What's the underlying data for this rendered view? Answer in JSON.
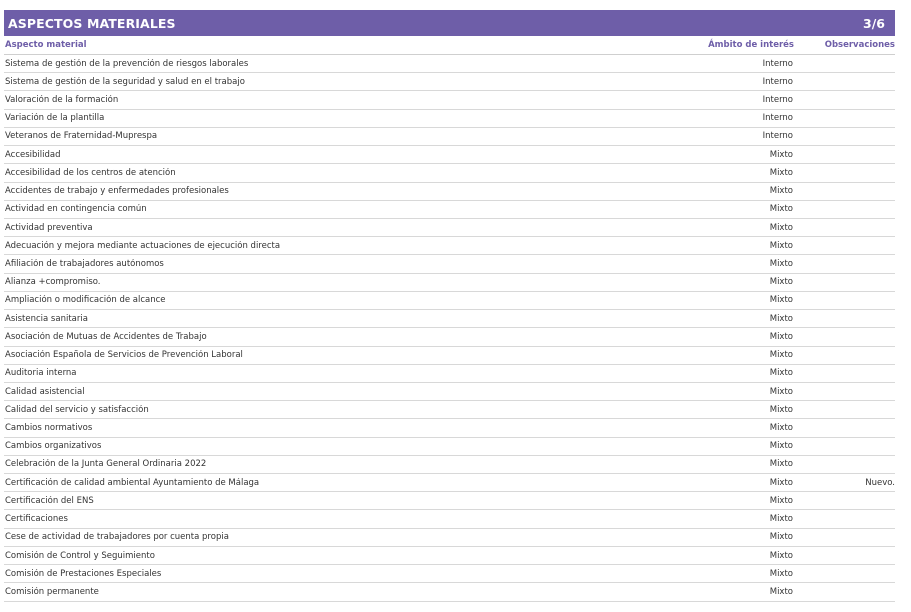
{
  "header": {
    "title": "ASPECTOS MATERIALES",
    "page_indicator": "3/6"
  },
  "columns": {
    "aspecto": "Aspecto material",
    "ambito": "Ámbito de interés",
    "observaciones": "Observaciones"
  },
  "colors": {
    "accent": "#6e5ea8"
  },
  "rows": [
    {
      "aspecto": "Sistema de gestión de la prevención de riesgos laborales",
      "ambito": "Interno",
      "observaciones": ""
    },
    {
      "aspecto": "Sistema de gestión de la seguridad y salud en el trabajo",
      "ambito": "Interno",
      "observaciones": ""
    },
    {
      "aspecto": "Valoración de la formación",
      "ambito": "Interno",
      "observaciones": ""
    },
    {
      "aspecto": "Variación de la plantilla",
      "ambito": "Interno",
      "observaciones": ""
    },
    {
      "aspecto": "Veteranos de Fraternidad-Muprespa",
      "ambito": "Interno",
      "observaciones": ""
    },
    {
      "aspecto": "Accesibilidad",
      "ambito": "Mixto",
      "observaciones": ""
    },
    {
      "aspecto": "Accesibilidad de los centros de atención",
      "ambito": "Mixto",
      "observaciones": ""
    },
    {
      "aspecto": "Accidentes de trabajo y enfermedades profesionales",
      "ambito": "Mixto",
      "observaciones": ""
    },
    {
      "aspecto": "Actividad en contingencia común",
      "ambito": "Mixto",
      "observaciones": ""
    },
    {
      "aspecto": "Actividad preventiva",
      "ambito": "Mixto",
      "observaciones": ""
    },
    {
      "aspecto": "Adecuación y mejora mediante actuaciones de ejecución directa",
      "ambito": "Mixto",
      "observaciones": ""
    },
    {
      "aspecto": "Afiliación de trabajadores autónomos",
      "ambito": "Mixto",
      "observaciones": ""
    },
    {
      "aspecto": "Alianza +compromiso.",
      "ambito": "Mixto",
      "observaciones": ""
    },
    {
      "aspecto": "Ampliación o modificación de alcance",
      "ambito": "Mixto",
      "observaciones": ""
    },
    {
      "aspecto": "Asistencia sanitaria",
      "ambito": "Mixto",
      "observaciones": ""
    },
    {
      "aspecto": "Asociación de Mutuas de Accidentes de Trabajo",
      "ambito": "Mixto",
      "observaciones": ""
    },
    {
      "aspecto": "Asociación Española de Servicios de Prevención Laboral",
      "ambito": "Mixto",
      "observaciones": ""
    },
    {
      "aspecto": "Auditoria interna",
      "ambito": "Mixto",
      "observaciones": ""
    },
    {
      "aspecto": "Calidad asistencial",
      "ambito": "Mixto",
      "observaciones": ""
    },
    {
      "aspecto": "Calidad del servicio y satisfacción",
      "ambito": "Mixto",
      "observaciones": ""
    },
    {
      "aspecto": "Cambios normativos",
      "ambito": "Mixto",
      "observaciones": ""
    },
    {
      "aspecto": "Cambios organizativos",
      "ambito": "Mixto",
      "observaciones": ""
    },
    {
      "aspecto": "Celebración de la Junta General Ordinaria 2022",
      "ambito": "Mixto",
      "observaciones": ""
    },
    {
      "aspecto": "Certificación de calidad ambiental Ayuntamiento de Málaga",
      "ambito": "Mixto",
      "observaciones": "Nuevo."
    },
    {
      "aspecto": "Certificación del ENS",
      "ambito": "Mixto",
      "observaciones": ""
    },
    {
      "aspecto": "Certificaciones",
      "ambito": "Mixto",
      "observaciones": ""
    },
    {
      "aspecto": "Cese de actividad de trabajadores por cuenta propia",
      "ambito": "Mixto",
      "observaciones": ""
    },
    {
      "aspecto": "Comisión de Control y Seguimiento",
      "ambito": "Mixto",
      "observaciones": ""
    },
    {
      "aspecto": "Comisión de Prestaciones Especiales",
      "ambito": "Mixto",
      "observaciones": ""
    },
    {
      "aspecto": "Comisión permanente",
      "ambito": "Mixto",
      "observaciones": ""
    }
  ]
}
